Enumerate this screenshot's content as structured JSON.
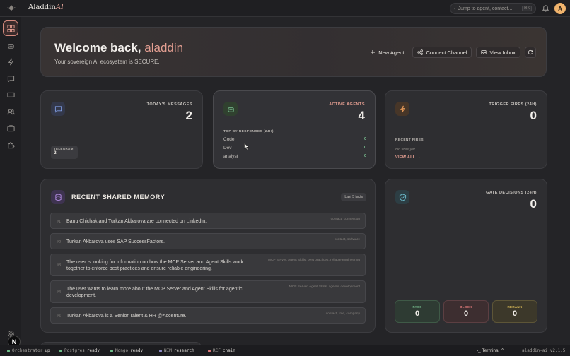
{
  "brand": {
    "name_main": "Aladdin",
    "name_accent": "AI"
  },
  "search": {
    "placeholder": "Jump to agent, contact...",
    "shortcut": "⌘K"
  },
  "user": {
    "avatar_initial": "A"
  },
  "sidebar": {
    "items": [
      {
        "name": "dashboard",
        "icon": "grid-icon",
        "active": true
      },
      {
        "name": "agents",
        "icon": "bot-icon"
      },
      {
        "name": "triggers",
        "icon": "bolt-icon"
      },
      {
        "name": "messages",
        "icon": "chat-icon"
      },
      {
        "name": "knowledge",
        "icon": "book-icon"
      },
      {
        "name": "contacts",
        "icon": "users-icon"
      },
      {
        "name": "tools",
        "icon": "briefcase-icon"
      },
      {
        "name": "skills",
        "icon": "puzzle-icon"
      }
    ]
  },
  "welcome": {
    "greeting": "Welcome back,",
    "username": "aladdin",
    "subtitle": "Your sovereign AI ecosystem is SECURE.",
    "actions": {
      "new_agent": "New Agent",
      "connect_channel": "Connect Channel",
      "view_inbox": "View Inbox"
    }
  },
  "stats": {
    "messages": {
      "label": "TODAY'S MESSAGES",
      "value": "2",
      "channel_label": "TELEGRAM",
      "channel_value": "2"
    },
    "agents": {
      "label": "ACTIVE AGENTS",
      "value": "4",
      "section": "TOP BY RESPONSES (24H)",
      "rows": [
        {
          "name": "Code",
          "count": "0"
        },
        {
          "name": "Dev",
          "count": "0"
        },
        {
          "name": "analyst",
          "count": "0"
        }
      ]
    },
    "triggers": {
      "label": "TRIGGER FIRES (24H)",
      "value": "0",
      "section": "RECENT FIRES",
      "empty": "No fires yet",
      "view_all": "VIEW ALL →"
    }
  },
  "memory": {
    "title": "RECENT SHARED MEMORY",
    "badge": "Last 5 facts",
    "facts": [
      {
        "num": "#1",
        "text": "Banu Chichak and Turkan Akbarova are connected on LinkedIn.",
        "tags": "contact, connection"
      },
      {
        "num": "#2",
        "text": "Turkan Akbarova uses SAP SuccessFactors.",
        "tags": "contact, software"
      },
      {
        "num": "#3",
        "text": "The user is looking for information on how the MCP Server and Agent Skills work together to enforce best practices and ensure reliable engineering.",
        "tags": "MCP Server, Agent Skills, best practices, reliable engineering"
      },
      {
        "num": "#4",
        "text": "The user wants to learn more about the MCP Server and Agent Skills for agentic development.",
        "tags": "MCP Server, Agent Skills, agentic development"
      },
      {
        "num": "#5",
        "text": "Turkan Akbarova is a Senior Talent & HR @Accenture.",
        "tags": "contact, role, company"
      }
    ]
  },
  "gate": {
    "label": "GATE DECISIONS (24H)",
    "value": "0",
    "pass": {
      "label": "PASS",
      "value": "0",
      "color": "#7bc493"
    },
    "block": {
      "label": "BLOCK",
      "value": "0",
      "color": "#e07a7a"
    },
    "rerank": {
      "label": "RERANK",
      "value": "0",
      "color": "#e2c15a"
    }
  },
  "statusbar": {
    "items": [
      {
        "label": "Orchestrator",
        "state": "up",
        "color": "#6fbf8a"
      },
      {
        "label": "Postgres",
        "state": "ready",
        "color": "#6fbf8a"
      },
      {
        "label": "Mongo",
        "state": "ready",
        "color": "#6fbf8a"
      },
      {
        "label": "NIM",
        "state": "research",
        "color": "#8f8cc8"
      },
      {
        "label": "RCF",
        "state": "chain",
        "color": "#e07a7a"
      }
    ],
    "terminal": "Terminal",
    "version": "aladdin-ai v2.1.5"
  },
  "fab_label": "N",
  "colors": {
    "accent": "#e59f92",
    "success": "#7bc493",
    "warning": "#e2c15a",
    "danger": "#e07a7a"
  }
}
